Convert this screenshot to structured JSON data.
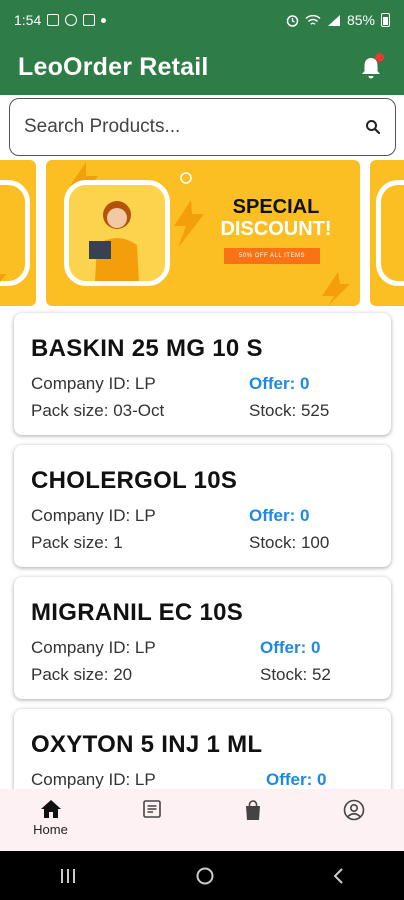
{
  "status_bar": {
    "time": "1:54",
    "battery_text": "85%"
  },
  "app": {
    "title": "LeoOrder Retail"
  },
  "search": {
    "placeholder": "Search Products..."
  },
  "banner": {
    "title_line1": "SPECIAL",
    "title_line2": "DISCOUNT!",
    "subtitle": "50% OFF ALL ITEMS"
  },
  "products": [
    {
      "name": "BASKIN 25 MG 10 S",
      "company": "Company ID: LP",
      "offer": "Offer: 0",
      "pack": "Pack size: 03-Oct",
      "stock": "Stock: 525"
    },
    {
      "name": "CHOLERGOL 10S",
      "company": "Company ID: LP",
      "offer": "Offer: 0",
      "pack": "Pack size: 1",
      "stock": "Stock: 100"
    },
    {
      "name": "MIGRANIL EC 10S",
      "company": "Company ID: LP",
      "offer": "Offer: 0",
      "pack": "Pack size: 20",
      "stock": "Stock: 52"
    },
    {
      "name": "OXYTON 5 INJ 1 ML",
      "company": "Company ID: LP",
      "offer": "Offer: 0",
      "pack": "",
      "stock": ""
    }
  ],
  "bottom_nav": {
    "items": [
      {
        "label": "Home",
        "icon": "home-icon",
        "active": true
      },
      {
        "label": "",
        "icon": "orders-icon",
        "active": false
      },
      {
        "label": "",
        "icon": "shopping-bag-icon",
        "active": false
      },
      {
        "label": "",
        "icon": "profile-icon",
        "active": false
      }
    ]
  },
  "colors": {
    "primary": "#2e7d46",
    "offer": "#1e88e5",
    "banner": "#fbbf24",
    "badge": "#e53935"
  }
}
